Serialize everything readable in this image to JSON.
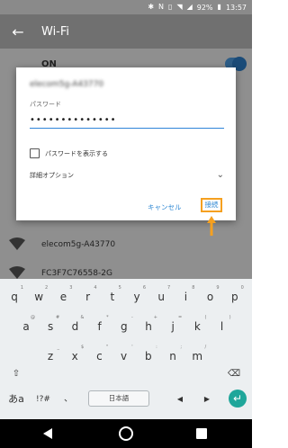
{
  "status_bar": {
    "battery": "92%",
    "time": "13:57",
    "icons": [
      "bluetooth-icon",
      "nfc-icon",
      "vibrate-icon",
      "wifi-icon",
      "signal-icon",
      "battery-icon"
    ]
  },
  "app_bar": {
    "title": "Wi-Fi",
    "back_icon": "arrow-left-icon"
  },
  "wifi": {
    "on_label": "ON",
    "networks": [
      {
        "name": "elecom5g-A43770"
      },
      {
        "name": "FC3F7C76558-2G"
      }
    ]
  },
  "dialog": {
    "ssid": "elecom5g-A43770",
    "password_label": "パスワード",
    "password_value": "••••••••••••••",
    "show_password_label": "パスワードを表示する",
    "show_password_checked": false,
    "advanced_label": "詳細オプション",
    "cancel_label": "キャンセル",
    "connect_label": "接続"
  },
  "keyboard": {
    "row1": [
      {
        "k": "q",
        "h": "1"
      },
      {
        "k": "w",
        "h": "2"
      },
      {
        "k": "e",
        "h": "3"
      },
      {
        "k": "r",
        "h": "4"
      },
      {
        "k": "t",
        "h": "5"
      },
      {
        "k": "y",
        "h": "6"
      },
      {
        "k": "u",
        "h": "7"
      },
      {
        "k": "i",
        "h": "8"
      },
      {
        "k": "o",
        "h": "9"
      },
      {
        "k": "p",
        "h": "0"
      }
    ],
    "row2": [
      {
        "k": "a",
        "h": "@"
      },
      {
        "k": "s",
        "h": "#"
      },
      {
        "k": "d",
        "h": "&"
      },
      {
        "k": "f",
        "h": "*"
      },
      {
        "k": "g",
        "h": "-"
      },
      {
        "k": "h",
        "h": "+"
      },
      {
        "k": "j",
        "h": "="
      },
      {
        "k": "k",
        "h": "("
      },
      {
        "k": "l",
        "h": ")"
      }
    ],
    "row3": [
      {
        "k": "z",
        "h": "_"
      },
      {
        "k": "x",
        "h": "$"
      },
      {
        "k": "c",
        "h": "\""
      },
      {
        "k": "v",
        "h": "'"
      },
      {
        "k": "b",
        "h": ":"
      },
      {
        "k": "n",
        "h": ";"
      },
      {
        "k": "m",
        "h": "/"
      }
    ],
    "shift_label": "⇧",
    "backspace_label": "⌫",
    "lang_toggle_label": "あa",
    "symbols_label": "!?#",
    "comma_label": "、",
    "space_label": "日本語",
    "left_label": "◀",
    "right_label": "▶",
    "enter_label": "↵"
  }
}
